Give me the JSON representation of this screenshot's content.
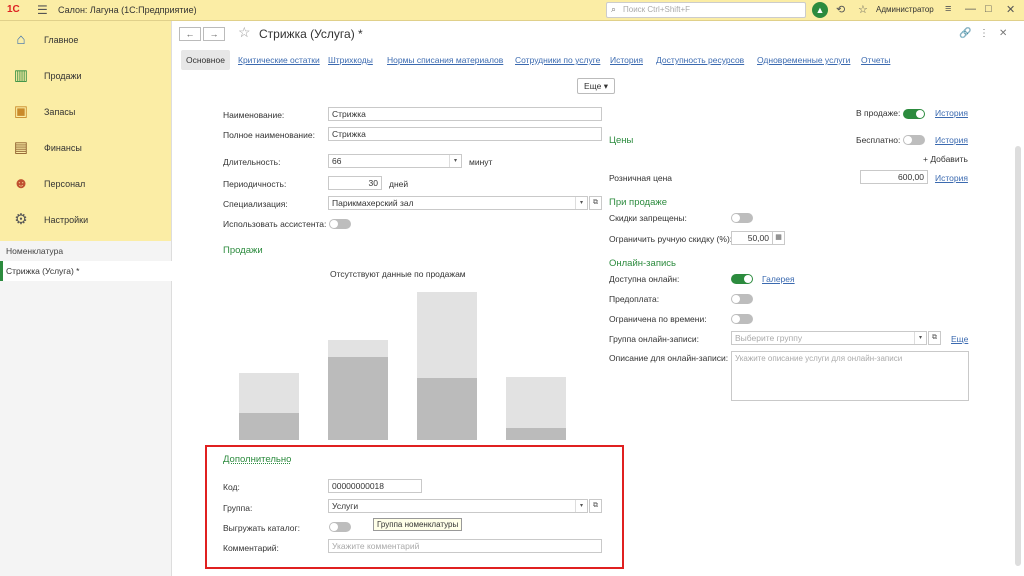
{
  "app": {
    "logo": "1С",
    "title": "Салон: Лагуна (1С:Предприятие)",
    "search_placeholder": "Поиск Ctrl+Shift+F",
    "user": "Администратор"
  },
  "sidebar": {
    "items": [
      {
        "label": "Главное",
        "icon": "house-icon"
      },
      {
        "label": "Продажи",
        "icon": "chart-icon"
      },
      {
        "label": "Запасы",
        "icon": "box-icon"
      },
      {
        "label": "Финансы",
        "icon": "wallet-icon"
      },
      {
        "label": "Персонал",
        "icon": "people-icon"
      },
      {
        "label": "Настройки",
        "icon": "gear-icon"
      }
    ],
    "section": "Номенклатура",
    "open_tab": "Стрижка (Услуга) *"
  },
  "header": {
    "title": "Стрижка (Услуга) *"
  },
  "tabs": [
    "Основное",
    "Критические остатки",
    "Штрихкоды",
    "Нормы списания материалов",
    "Сотрудники по услуге",
    "История",
    "Доступность ресурсов",
    "Одновременные услуги",
    "Отчеты"
  ],
  "more": "Еще ▾",
  "left": {
    "name_label": "Наименование:",
    "name_value": "Стрижка",
    "fullname_label": "Полное наименование:",
    "fullname_value": "Стрижка",
    "duration_label": "Длительность:",
    "duration_value": "66",
    "duration_unit": "минут",
    "period_label": "Периодичность:",
    "period_value": "30",
    "period_unit": "дней",
    "spec_label": "Специализация:",
    "spec_value": "Парикмахерский зал",
    "assistant_label": "Использовать ассистента:",
    "sales_header": "Продажи",
    "no_data": "Отсутствуют данные по продажам"
  },
  "additional": {
    "header": "Дополнительно",
    "code_label": "Код:",
    "code_value": "00000000018",
    "group_label": "Группа:",
    "group_value": "Услуги",
    "export_label": "Выгружать каталог:",
    "comment_label": "Комментарий:",
    "comment_placeholder": "Укажите комментарий",
    "tooltip": "Группа номенклатуры"
  },
  "right": {
    "on_sale_label": "В продаже:",
    "history": "История",
    "prices_header": "Цены",
    "free_label": "Бесплатно:",
    "add": "+ Добавить",
    "retail_label": "Розничная цена",
    "retail_value": "600,00",
    "at_sale_header": "При продаже",
    "discounts_label": "Скидки запрещены:",
    "limit_label": "Ограничить ручную скидку (%):",
    "limit_value": "50,00",
    "online_header": "Онлайн-запись",
    "available_label": "Доступна онлайн:",
    "gallery": "Галерея",
    "prepay_label": "Предоплата:",
    "time_limit_label": "Ограничена по времени:",
    "group_label": "Группа онлайн-записи:",
    "group_placeholder": "Выберите группу",
    "more": "Еще",
    "desc_label": "Описание для онлайн-записи:",
    "desc_placeholder": "Укажите описание услуги для онлайн-записи"
  },
  "colors": {
    "accent": "#2c8b3e",
    "topbar": "#fbeda5",
    "highlight": "#e02020"
  }
}
